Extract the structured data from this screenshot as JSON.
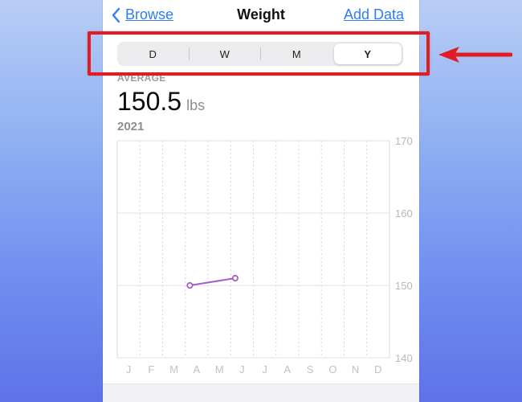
{
  "navbar": {
    "back_label": "Browse",
    "title": "Weight",
    "add_label": "Add Data"
  },
  "segments": [
    {
      "label": "D",
      "selected": false
    },
    {
      "label": "W",
      "selected": false
    },
    {
      "label": "M",
      "selected": false
    },
    {
      "label": "Y",
      "selected": true
    }
  ],
  "summary": {
    "label": "AVERAGE",
    "value": "150.5",
    "unit": "lbs",
    "period": "2021"
  },
  "chart_data": {
    "type": "line",
    "x": [
      "J",
      "F",
      "M",
      "A",
      "M",
      "J",
      "J",
      "A",
      "S",
      "O",
      "N",
      "D"
    ],
    "y_ticks": [
      170,
      160,
      150,
      140
    ],
    "ylim": [
      140,
      170
    ],
    "series": [
      {
        "color": "#a35fc9",
        "points": [
          {
            "x": 3.2,
            "y": 150
          },
          {
            "x": 5.2,
            "y": 151
          }
        ]
      }
    ],
    "grid": true
  },
  "annotation": {
    "highlight_color": "#e31b23"
  }
}
